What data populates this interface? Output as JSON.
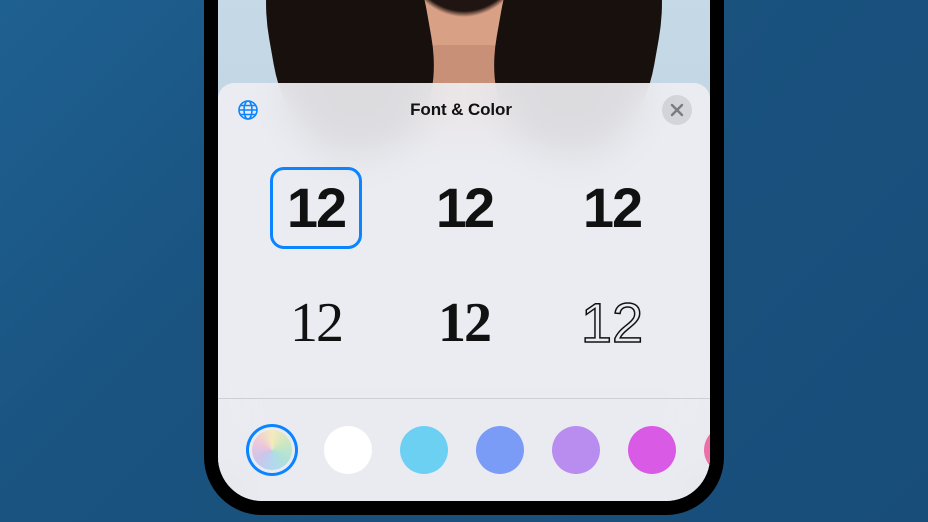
{
  "panel": {
    "title": "Font & Color",
    "globe_icon": "globe-icon",
    "close_icon": "close-icon"
  },
  "fonts": {
    "sample": "12",
    "options": [
      {
        "id": "sf-pro-rounded",
        "selected": true
      },
      {
        "id": "sf-pro-heavy",
        "selected": false
      },
      {
        "id": "stencil",
        "selected": false
      },
      {
        "id": "new-york-serif",
        "selected": false
      },
      {
        "id": "serif-bold",
        "selected": false
      },
      {
        "id": "outline-inline",
        "selected": false
      }
    ]
  },
  "colors": {
    "options": [
      {
        "id": "dynamic-rainbow",
        "hex": "rainbow",
        "selected": true
      },
      {
        "id": "white",
        "hex": "#ffffff",
        "selected": false
      },
      {
        "id": "sky-blue",
        "hex": "#6cd0f2",
        "selected": false
      },
      {
        "id": "periwinkle",
        "hex": "#7a9cf6",
        "selected": false
      },
      {
        "id": "lavender",
        "hex": "#b98cf0",
        "selected": false
      },
      {
        "id": "magenta",
        "hex": "#d95ae4",
        "selected": false
      },
      {
        "id": "pink",
        "hex": "#ed6fa8",
        "selected": false
      }
    ]
  }
}
